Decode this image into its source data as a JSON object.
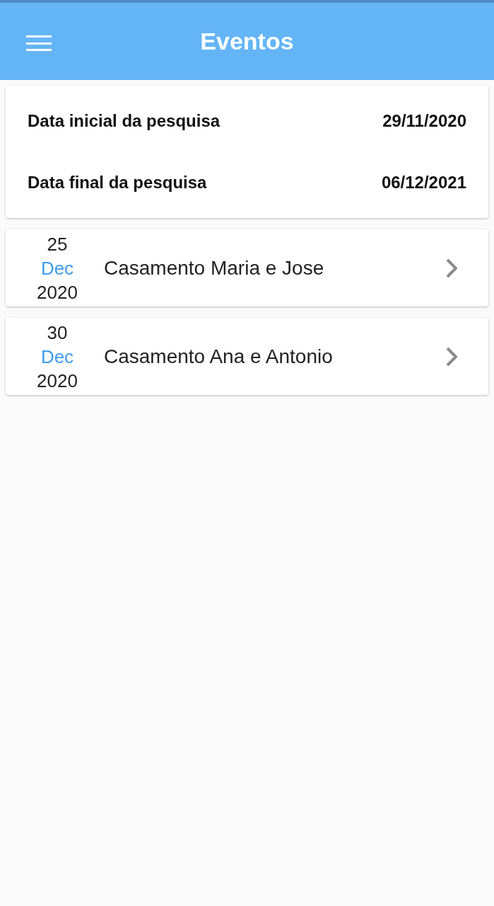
{
  "app_bar": {
    "title": "Eventos"
  },
  "search_range": [
    {
      "label": "Data inicial da pesquisa",
      "value": "29/11/2020"
    },
    {
      "label": "Data final da pesquisa",
      "value": "06/12/2021"
    }
  ],
  "events": [
    {
      "day": "25",
      "month": "Dec",
      "year": "2020",
      "title": "Casamento Maria e Jose"
    },
    {
      "day": "30",
      "month": "Dec",
      "year": "2020",
      "title": "Casamento Ana e Antonio"
    }
  ]
}
